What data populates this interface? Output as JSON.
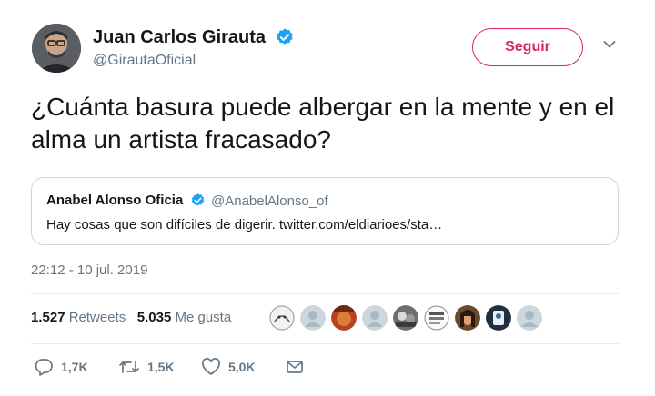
{
  "author": {
    "name": "Juan Carlos Girauta",
    "handle": "@GirautaOficial",
    "verified_icon": "verified-badge-icon"
  },
  "follow_label": "Seguir",
  "colors": {
    "accent": "#e0245e",
    "verified": "#1da1f2",
    "muted": "#657786"
  },
  "tweet_text": "¿Cuánta basura puede albergar en la mente y en el alma un artista fracasado?",
  "quote": {
    "name": "Anabel Alonso Oficia",
    "handle": "@AnabelAlonso_of",
    "text": "Hay cosas que son difíciles de digerir. twitter.com/eldiarioes/sta…"
  },
  "timestamp": "22:12 - 10 jul. 2019",
  "stats": {
    "retweets_count": "1.527",
    "retweets_label": "Retweets",
    "likes_count": "5.035",
    "likes_label": "Me gusta"
  },
  "actions": {
    "reply_count": "1,7K",
    "retweet_count": "1,5K",
    "like_count": "5,0K"
  }
}
